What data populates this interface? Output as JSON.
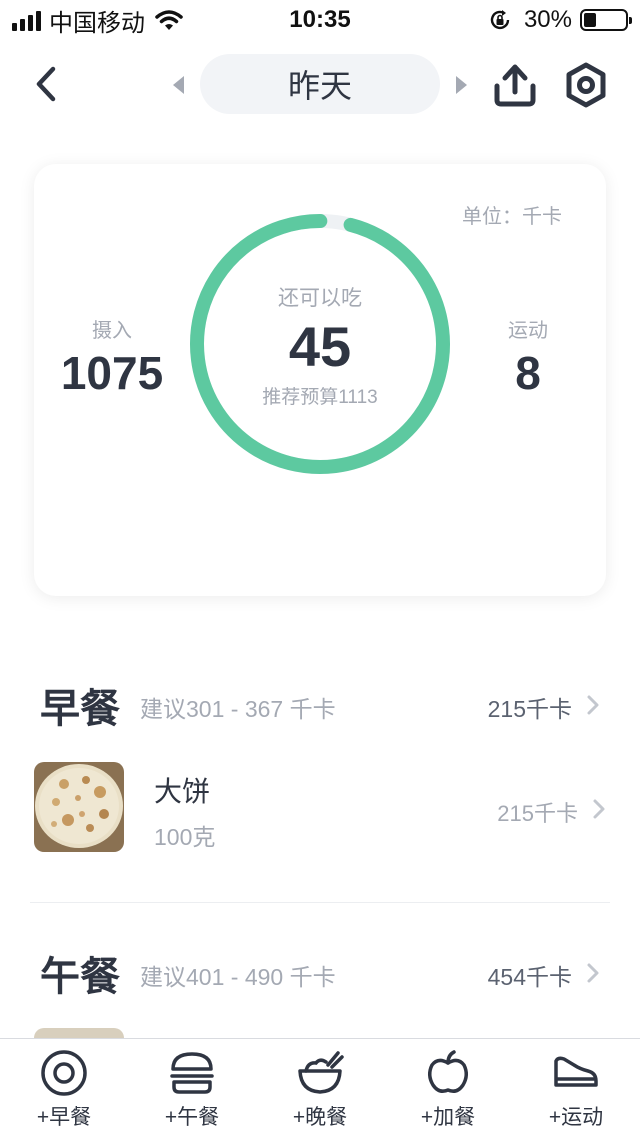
{
  "status_bar": {
    "carrier": "中国移动",
    "time": "10:35",
    "battery": "30%",
    "battery_level": 0.3,
    "icons": [
      "signal-icon",
      "wifi-icon",
      "rotation-lock-icon",
      "battery-icon"
    ]
  },
  "nav": {
    "date_label": "昨天",
    "icons": [
      "back-chevron-icon",
      "prev-day-triangle-icon",
      "next-day-triangle-icon",
      "share-upload-icon",
      "hexagon-settings-icon"
    ]
  },
  "summary": {
    "unit": "单位：千卡",
    "intake_label": "摄入",
    "intake_value": "1075",
    "exercise_label": "运动",
    "exercise_value": "8",
    "remaining_label": "还可以吃",
    "remaining_value": "45",
    "budget_label": "推荐预算1113",
    "ring_progress": 0.96,
    "ring_color": "#5dc9a0",
    "ring_track_color": "#eef1f4"
  },
  "meals": [
    {
      "name": "早餐",
      "suggestion": "建议301 - 367 千卡",
      "total": "215千卡",
      "foods": [
        {
          "name": "大饼",
          "amount": "100克",
          "calories": "215千卡"
        }
      ]
    },
    {
      "name": "午餐",
      "suggestion": "建议401 - 490 千卡",
      "total": "454千卡",
      "foods": []
    }
  ],
  "tabs": [
    {
      "label": "+早餐",
      "icon": "fried-egg-icon"
    },
    {
      "label": "+午餐",
      "icon": "burger-icon"
    },
    {
      "label": "+晚餐",
      "icon": "rice-bowl-icon"
    },
    {
      "label": "+加餐",
      "icon": "apple-icon"
    },
    {
      "label": "+运动",
      "icon": "sneaker-icon"
    }
  ],
  "colors": {
    "text_primary": "#2f3542",
    "text_secondary": "#a4a9b3",
    "accent": "#5dc9a0"
  }
}
